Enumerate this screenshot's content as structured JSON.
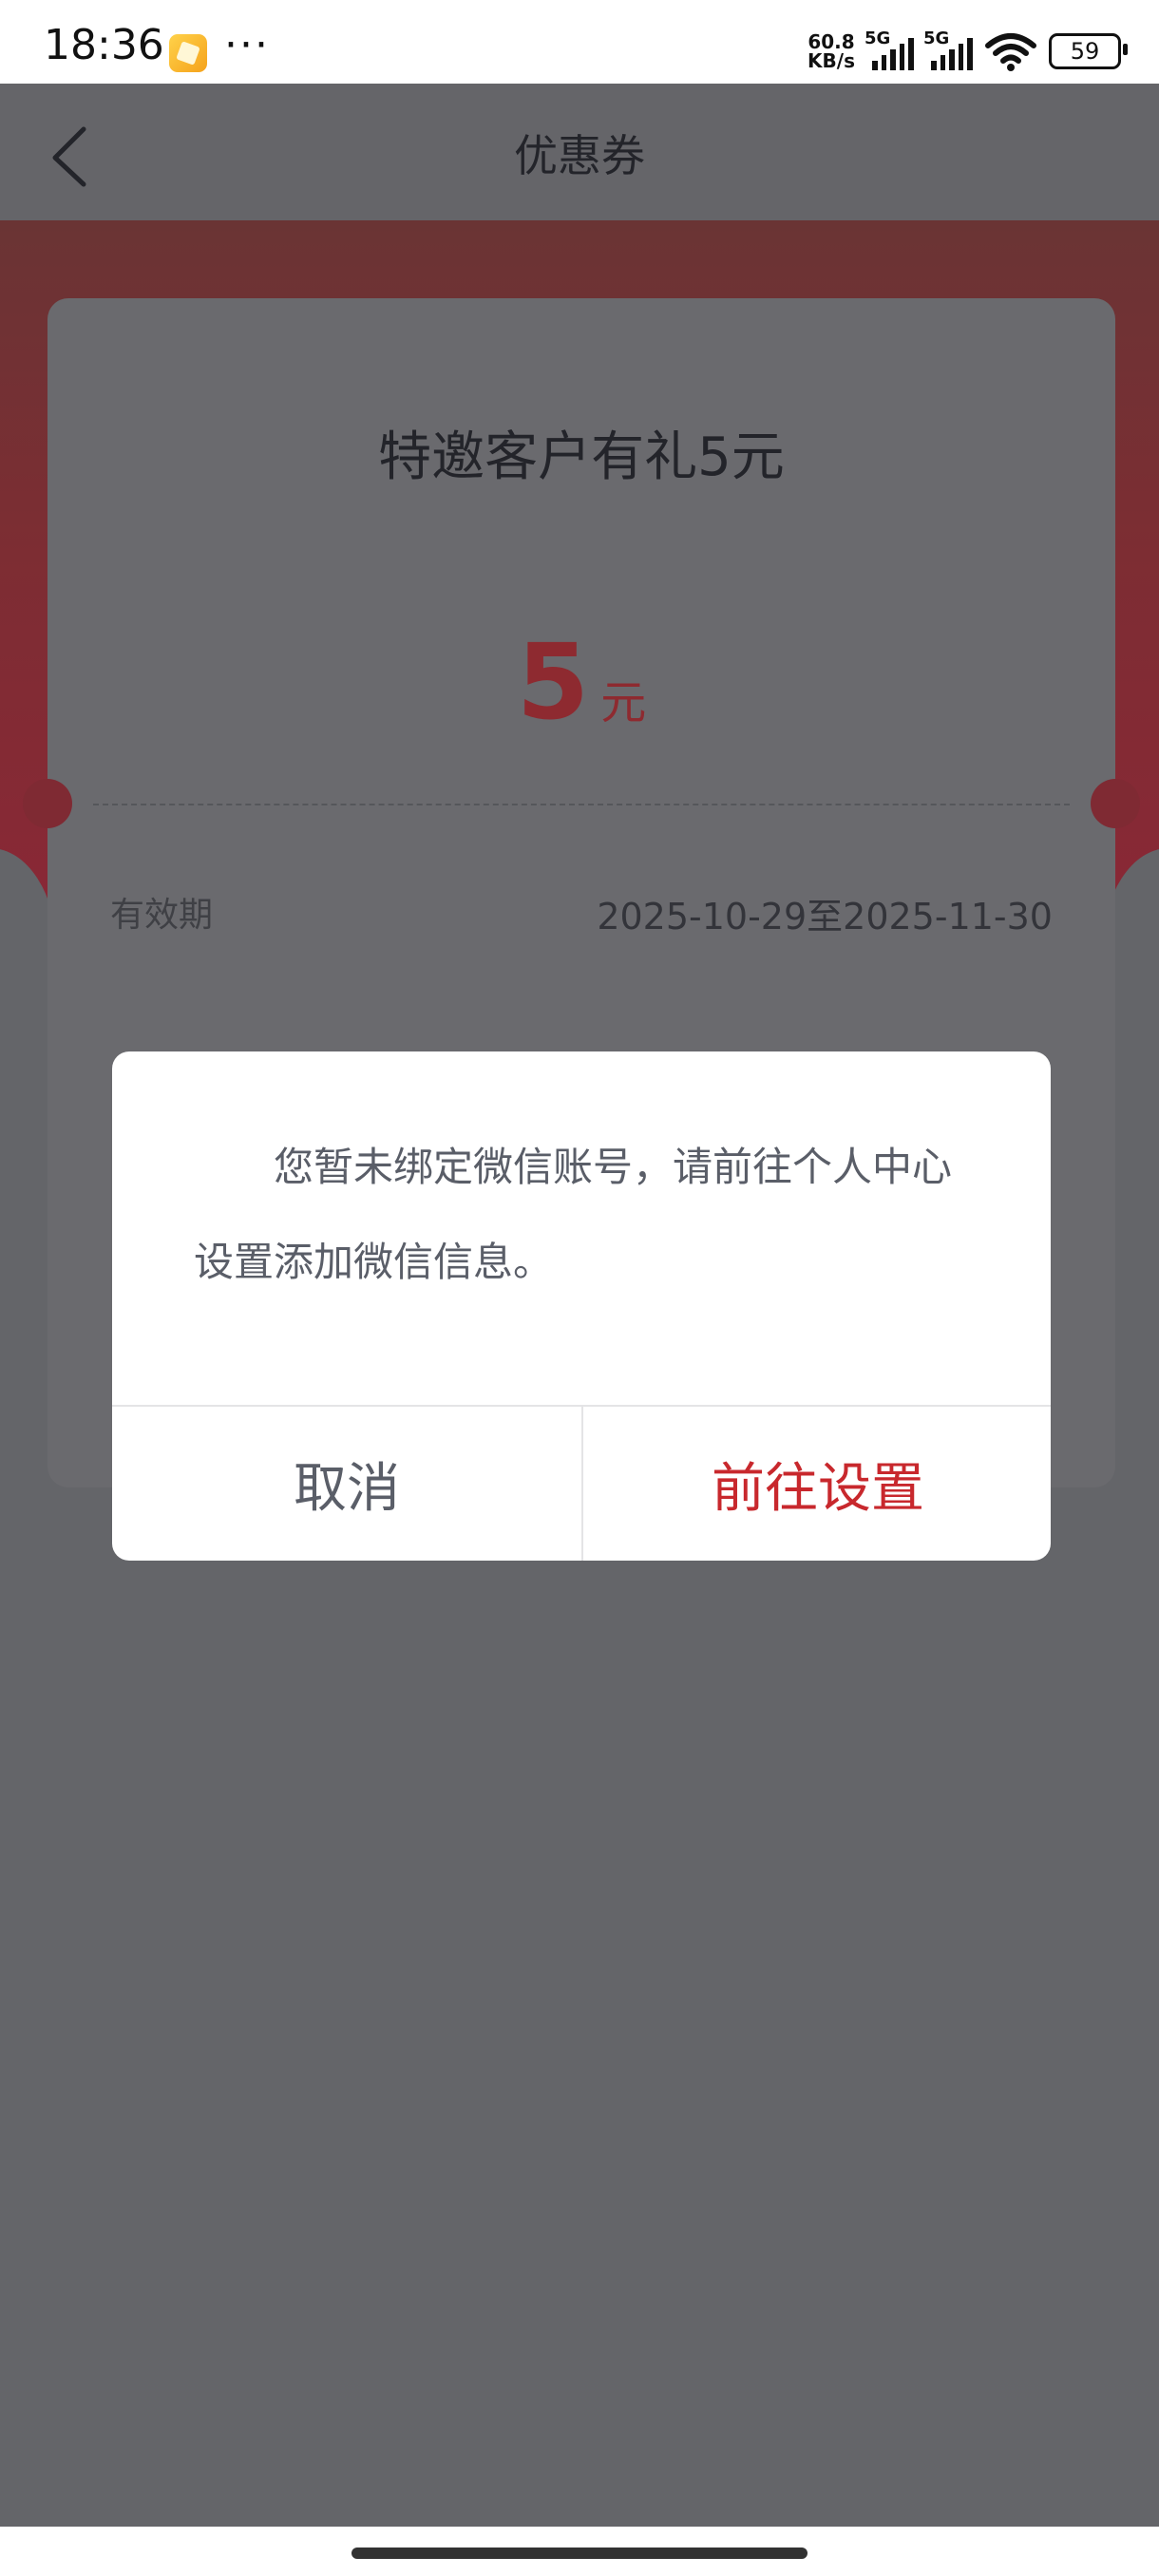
{
  "status_bar": {
    "time": "18:36",
    "more": "···",
    "net_speed_value": "60.8",
    "net_speed_unit": "KB/s",
    "signal1_label": "5G",
    "signal2_label": "5G",
    "battery": "59",
    "app_icon": "notes-app-icon",
    "wifi_icon": "wifi-icon"
  },
  "header": {
    "title": "优惠券",
    "back_icon": "chevron-left-icon"
  },
  "coupon": {
    "title": "特邀客户有礼5元",
    "amount": "5",
    "unit": "元",
    "validity_label": "有效期",
    "validity_value": "2025-10-29至2025-11-30"
  },
  "dialog": {
    "message": "您暂未绑定微信账号，请前往个人中心设置添加微信信息。",
    "cancel_label": "取消",
    "confirm_label": "前往设置"
  },
  "colors": {
    "accent": "#c8282d",
    "overlay": "#646569",
    "amount_color": "#8e2a30"
  }
}
